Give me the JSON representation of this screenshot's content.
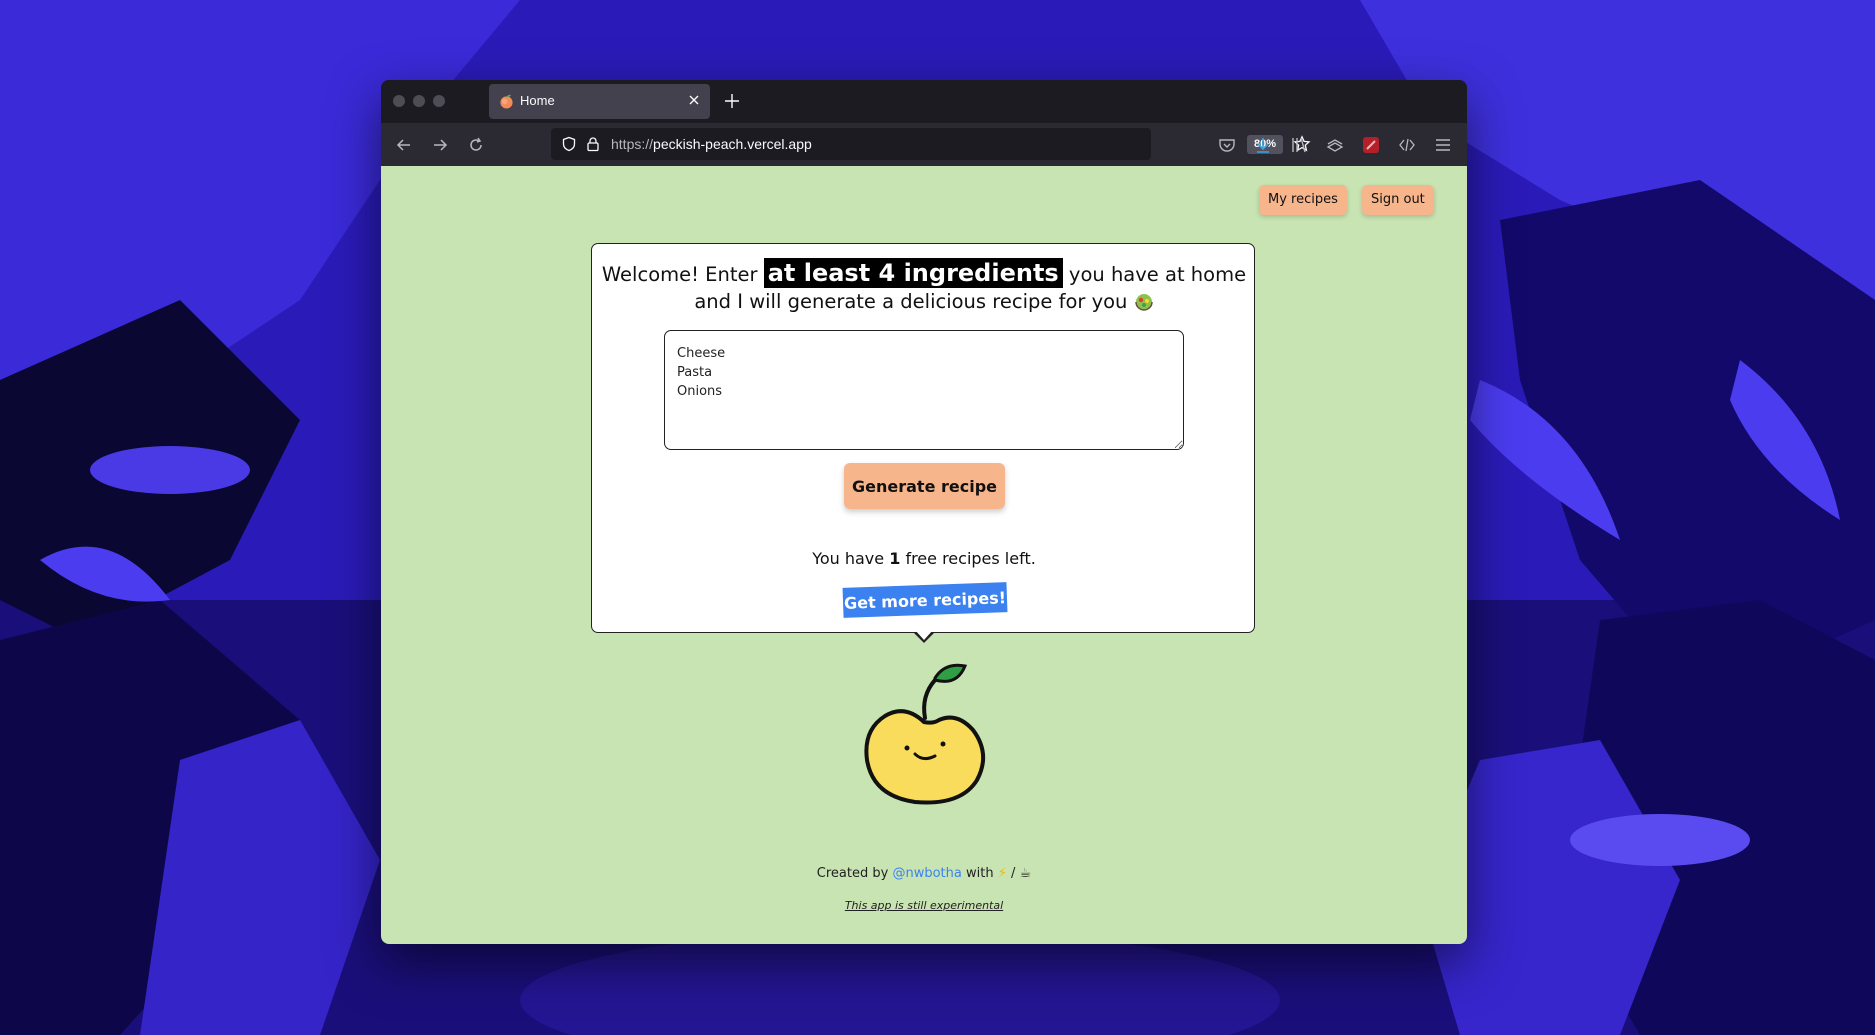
{
  "browser": {
    "tab": {
      "title": "Home",
      "favicon": "peach-icon"
    },
    "url": {
      "protocol": "https://",
      "host": "peckish-peach.vercel.app"
    },
    "zoom": "80%"
  },
  "header": {
    "my_recipes_label": "My recipes",
    "sign_out_label": "Sign out"
  },
  "main": {
    "headline_before": "Welcome! Enter",
    "headline_highlight": "at least 4 ingredients",
    "headline_after": "you have at home and I will generate a delicious recipe for you",
    "headline_emoji": "salad-icon",
    "ingredients_value": "Cheese\nPasta\nOnions",
    "generate_label": "Generate recipe",
    "free_prefix": "You have",
    "free_count": "1",
    "free_suffix": "free recipes left.",
    "get_more_label": "Get more recipes!"
  },
  "footer": {
    "created_by": "Created by",
    "author": "@nwbotha",
    "with": "with",
    "separator": "/",
    "lightning_icon": "lightning-icon",
    "coffee_icon": "coffee-icon",
    "note": "This app is still experimental"
  },
  "colors": {
    "page_bg": "#c8e4b2",
    "button_peach": "#f7b58c",
    "link_blue": "#3b82f0",
    "wallpaper": "#3d2bd6"
  }
}
